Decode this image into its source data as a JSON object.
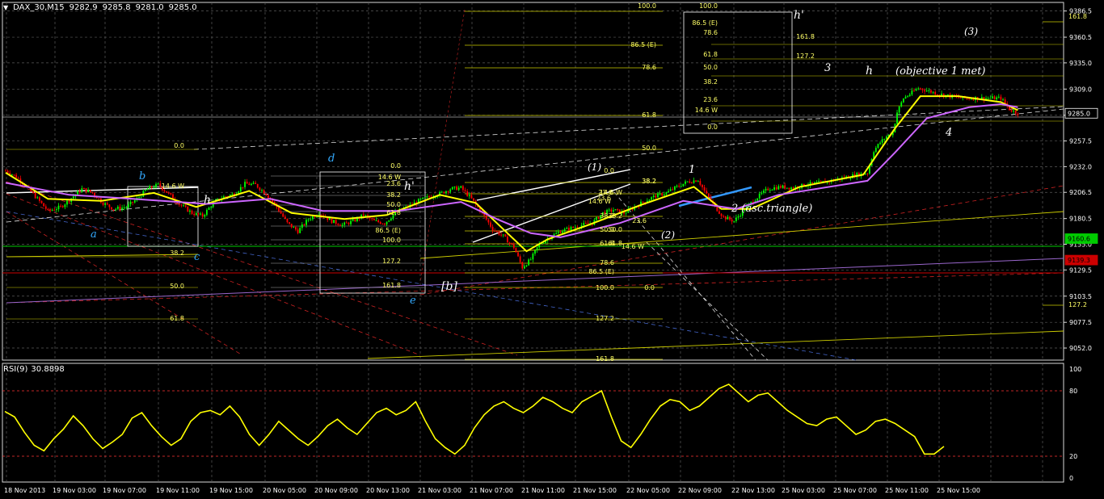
{
  "header": {
    "symbol": "DAX_30,M15",
    "open": "9282.9",
    "high": "9285.8",
    "low": "9281.0",
    "close": "9285.0"
  },
  "rsi_header": {
    "label": "RSI(9)",
    "value": "30.8898"
  },
  "colors": {
    "background": "#000000",
    "grid": "#5a5a5a",
    "candle_up": "#00ff00",
    "candle_down": "#ff0000",
    "fast_ma": "#ffff00",
    "slow_ma": "#cc66ff",
    "fib": "#cccc00",
    "fib_label": "#ffff66",
    "rsi": "#ffff00",
    "rsi_level": "#ff3333",
    "wave_blue": "#33aaff",
    "annotation": "#ffffff"
  },
  "chart_data": [
    {
      "type": "candlestick",
      "symbol": "DAX_30",
      "timeframe": "M15",
      "x_labels": [
        "18 Nov 2013",
        "19 Nov 03:00",
        "19 Nov 07:00",
        "19 Nov 11:00",
        "19 Nov 15:00",
        "20 Nov 05:00",
        "20 Nov 09:00",
        "20 Nov 13:00",
        "21 Nov 03:00",
        "21 Nov 07:00",
        "21 Nov 11:00",
        "21 Nov 15:00",
        "22 Nov 05:00",
        "22 Nov 09:00",
        "22 Nov 13:00",
        "25 Nov 03:00",
        "25 Nov 07:00",
        "25 Nov 11:00",
        "25 Nov 15:00"
      ],
      "y_ticks": [
        9386.5,
        9360.5,
        9335.0,
        9309.0,
        9283.0,
        9257.5,
        9232.0,
        9206.5,
        9180.5,
        9155.0,
        9129.5,
        9103.5,
        9077.5,
        9052.0
      ],
      "ylim": [
        9040,
        9395
      ],
      "price_tags": [
        {
          "value": 9285.0,
          "label": "9285.0",
          "color": "#ffffff"
        },
        {
          "value": 9160.6,
          "label": "9160.6",
          "color": "#00cc00"
        },
        {
          "value": 9139.3,
          "label": "9139.3",
          "color": "#cc0000"
        }
      ],
      "close_path": [
        [
          0,
          9228
        ],
        [
          5,
          9222
        ],
        [
          10,
          9212
        ],
        [
          15,
          9200
        ],
        [
          20,
          9188
        ],
        [
          26,
          9192
        ],
        [
          30,
          9199
        ],
        [
          36,
          9210
        ],
        [
          41,
          9206
        ],
        [
          46,
          9196
        ],
        [
          51,
          9190
        ],
        [
          57,
          9192
        ],
        [
          62,
          9200
        ],
        [
          67,
          9210
        ],
        [
          72,
          9214
        ],
        [
          77,
          9205
        ],
        [
          82,
          9195
        ],
        [
          88,
          9186
        ],
        [
          93,
          9183
        ],
        [
          98,
          9196
        ],
        [
          103,
          9202
        ],
        [
          108,
          9205
        ],
        [
          113,
          9215
        ],
        [
          118,
          9214
        ],
        [
          123,
          9205
        ],
        [
          128,
          9192
        ],
        [
          133,
          9176
        ],
        [
          138,
          9168
        ],
        [
          143,
          9180
        ],
        [
          148,
          9186
        ],
        [
          154,
          9178
        ],
        [
          159,
          9174
        ],
        [
          164,
          9178
        ],
        [
          169,
          9184
        ],
        [
          174,
          9178
        ],
        [
          179,
          9176
        ],
        [
          184,
          9186
        ],
        [
          190,
          9192
        ],
        [
          195,
          9198
        ],
        [
          200,
          9202
        ],
        [
          205,
          9205
        ],
        [
          210,
          9210
        ],
        [
          215,
          9211
        ],
        [
          220,
          9200
        ],
        [
          225,
          9186
        ],
        [
          230,
          9170
        ],
        [
          235,
          9163
        ],
        [
          240,
          9152
        ],
        [
          244,
          9132
        ],
        [
          248,
          9140
        ],
        [
          252,
          9155
        ],
        [
          257,
          9162
        ],
        [
          262,
          9168
        ],
        [
          267,
          9171
        ],
        [
          272,
          9174
        ],
        [
          277,
          9176
        ],
        [
          282,
          9186
        ],
        [
          287,
          9189
        ],
        [
          292,
          9186
        ],
        [
          297,
          9192
        ],
        [
          302,
          9198
        ],
        [
          307,
          9203
        ],
        [
          312,
          9206
        ],
        [
          317,
          9212
        ],
        [
          322,
          9217
        ],
        [
          327,
          9219
        ],
        [
          331,
          9204
        ],
        [
          335,
          9192
        ],
        [
          339,
          9182
        ],
        [
          344,
          9178
        ],
        [
          349,
          9190
        ],
        [
          354,
          9200
        ],
        [
          360,
          9210
        ],
        [
          366,
          9212
        ],
        [
          372,
          9211
        ],
        [
          378,
          9214
        ],
        [
          384,
          9216
        ],
        [
          390,
          9218
        ],
        [
          396,
          9221
        ],
        [
          402,
          9224
        ],
        [
          407,
          9226
        ],
        [
          410,
          9248
        ],
        [
          413,
          9256
        ],
        [
          416,
          9262
        ],
        [
          419,
          9266
        ],
        [
          421,
          9286
        ],
        [
          424,
          9300
        ],
        [
          427,
          9304
        ],
        [
          431,
          9310
        ],
        [
          436,
          9307
        ],
        [
          441,
          9304
        ],
        [
          446,
          9302
        ],
        [
          452,
          9300
        ],
        [
          458,
          9300
        ],
        [
          464,
          9300
        ],
        [
          470,
          9300
        ],
        [
          474,
          9289
        ],
        [
          478,
          9285
        ]
      ],
      "moving_averages": [
        {
          "name": "fast",
          "color": "#ffff00",
          "points": [
            [
              0,
              9226
            ],
            [
              20,
              9200
            ],
            [
              45,
              9198
            ],
            [
              70,
              9206
            ],
            [
              90,
              9192
            ],
            [
              115,
              9208
            ],
            [
              135,
              9186
            ],
            [
              160,
              9180
            ],
            [
              180,
              9184
            ],
            [
              205,
              9204
            ],
            [
              222,
              9196
            ],
            [
              236,
              9168
            ],
            [
              246,
              9148
            ],
            [
              256,
              9160
            ],
            [
              275,
              9174
            ],
            [
              300,
              9194
            ],
            [
              325,
              9212
            ],
            [
              338,
              9190
            ],
            [
              352,
              9190
            ],
            [
              375,
              9212
            ],
            [
              405,
              9224
            ],
            [
              420,
              9270
            ],
            [
              432,
              9302
            ],
            [
              450,
              9302
            ],
            [
              470,
              9296
            ],
            [
              478,
              9288
            ]
          ]
        },
        {
          "name": "slow",
          "color": "#cc66ff",
          "points": [
            [
              0,
              9216
            ],
            [
              30,
              9204
            ],
            [
              60,
              9200
            ],
            [
              95,
              9195
            ],
            [
              125,
              9200
            ],
            [
              150,
              9188
            ],
            [
              185,
              9188
            ],
            [
              215,
              9197
            ],
            [
              232,
              9180
            ],
            [
              248,
              9166
            ],
            [
              262,
              9162
            ],
            [
              290,
              9176
            ],
            [
              320,
              9198
            ],
            [
              345,
              9190
            ],
            [
              365,
              9204
            ],
            [
              395,
              9214
            ],
            [
              407,
              9218
            ],
            [
              420,
              9246
            ],
            [
              435,
              9280
            ],
            [
              455,
              9291
            ],
            [
              470,
              9294
            ],
            [
              478,
              9291
            ]
          ]
        }
      ]
    },
    {
      "type": "line",
      "name": "RSI(9)",
      "value": 30.8898,
      "y_ticks": [
        100,
        80,
        20,
        0
      ],
      "levels": [
        80,
        20
      ],
      "ylim": [
        0,
        100
      ],
      "values": [
        61,
        56,
        42,
        30,
        25,
        36,
        45,
        57,
        48,
        36,
        27,
        33,
        40,
        55,
        60,
        48,
        38,
        30,
        36,
        52,
        60,
        62,
        58,
        66,
        56,
        40,
        30,
        40,
        52,
        44,
        36,
        30,
        38,
        48,
        54,
        46,
        40,
        50,
        60,
        64,
        58,
        62,
        70,
        52,
        36,
        28,
        22,
        30,
        46,
        58,
        66,
        70,
        64,
        60,
        66,
        74,
        70,
        64,
        60,
        70,
        75,
        80,
        56,
        34,
        28,
        40,
        54,
        66,
        72,
        70,
        62,
        66,
        74,
        82,
        86,
        78,
        70,
        76,
        78,
        70,
        62,
        56,
        50,
        48,
        54,
        56,
        48,
        40,
        44,
        52,
        54,
        50,
        44,
        38,
        22,
        22,
        29
      ]
    }
  ],
  "fib_labels": [
    {
      "label": "100.0",
      "series": "top-center"
    },
    {
      "label": "86.5 (E)",
      "series": "top-center"
    },
    {
      "label": "78.6",
      "series": "top-center"
    },
    {
      "label": "61.8",
      "series": "top-center"
    },
    {
      "label": "50.0",
      "series": "top-center"
    },
    {
      "label": "38.2",
      "series": "top-center"
    },
    {
      "label": "23.6",
      "series": "top-center"
    },
    {
      "label": "14.6 W",
      "series": "top-center"
    },
    {
      "label": "0.0",
      "series": "top-center"
    },
    {
      "label": "38.2",
      "series": "top-center"
    },
    {
      "label": "50.0",
      "series": "top-center"
    },
    {
      "label": "61.8",
      "series": "top-center"
    },
    {
      "label": "78.6",
      "series": "top-center"
    },
    {
      "label": "86.5 (E)",
      "series": "top-center"
    },
    {
      "label": "100.0",
      "series": "top-center"
    },
    {
      "label": "0.0",
      "series": "top-center"
    },
    {
      "label": "127.2",
      "series": "top-center"
    },
    {
      "label": "161.8",
      "series": "top-center"
    },
    {
      "label": "100.0",
      "series": "box-right"
    },
    {
      "label": "86.5 (E)",
      "series": "box-right"
    },
    {
      "label": "78.6",
      "series": "box-right"
    },
    {
      "label": "61.8",
      "series": "box-right"
    },
    {
      "label": "50.0",
      "series": "box-right"
    },
    {
      "label": "38.2",
      "series": "box-right"
    },
    {
      "label": "23.6",
      "series": "box-right"
    },
    {
      "label": "14.6 W",
      "series": "box-right"
    },
    {
      "label": "0.0",
      "series": "box-right"
    },
    {
      "label": "161.8",
      "series": "box-right"
    },
    {
      "label": "127.2",
      "series": "box-right"
    },
    {
      "label": "0.0",
      "series": "left"
    },
    {
      "label": "38.2",
      "series": "left"
    },
    {
      "label": "50.0",
      "series": "left"
    },
    {
      "label": "61.8",
      "series": "left"
    },
    {
      "label": "14.6 W",
      "series": "left"
    },
    {
      "label": "14.6 W",
      "series": "box-mid"
    },
    {
      "label": "23.6",
      "series": "box-mid"
    },
    {
      "label": "38.2",
      "series": "box-mid"
    },
    {
      "label": "50.0",
      "series": "box-mid"
    },
    {
      "label": "61.8",
      "series": "box-mid"
    },
    {
      "label": "86.5 (E)",
      "series": "box-mid"
    },
    {
      "label": "100.0",
      "series": "box-mid"
    },
    {
      "label": "127.2",
      "series": "box-mid"
    },
    {
      "label": "161.8",
      "series": "box-mid"
    },
    {
      "label": "0.0",
      "series": "box-mid"
    },
    {
      "label": "161.8",
      "series": "far-right"
    },
    {
      "label": "127.2",
      "series": "far-right"
    },
    {
      "label": "38.2",
      "series": "small"
    },
    {
      "label": "23.6",
      "series": "small"
    },
    {
      "label": "14.6 W",
      "series": "small"
    },
    {
      "label": "38.2",
      "series": "small"
    },
    {
      "label": "50.0",
      "series": "small"
    },
    {
      "label": "61.8",
      "series": "small"
    },
    {
      "label": "14.6 W",
      "series": "small"
    },
    {
      "label": "23.6",
      "series": "small"
    }
  ],
  "wave_labels": [
    {
      "label": "a",
      "color": "#33aaff"
    },
    {
      "label": "b",
      "color": "#33aaff"
    },
    {
      "label": "c",
      "color": "#33aaff"
    },
    {
      "label": "d",
      "color": "#33aaff"
    },
    {
      "label": "e",
      "color": "#33aaff"
    },
    {
      "label": "h",
      "color": "#ffffff"
    },
    {
      "label": "h'",
      "color": "#ffffff"
    },
    {
      "label": "h'",
      "color": "#ffffff"
    },
    {
      "label": "h",
      "color": "#ffffff"
    },
    {
      "label": "[b]",
      "color": "#ffffff"
    },
    {
      "label": "(1)",
      "color": "#ffffff"
    },
    {
      "label": "(2)",
      "color": "#ffffff"
    },
    {
      "label": "1",
      "color": "#ffffff"
    },
    {
      "label": "2 (asc.triangle)",
      "color": "#ffffff"
    },
    {
      "label": "3",
      "color": "#ffffff"
    },
    {
      "label": "4",
      "color": "#ffffff"
    },
    {
      "label": "(3)",
      "color": "#ffffff"
    },
    {
      "label": "(objective 1 met)",
      "color": "#ffffff"
    }
  ]
}
